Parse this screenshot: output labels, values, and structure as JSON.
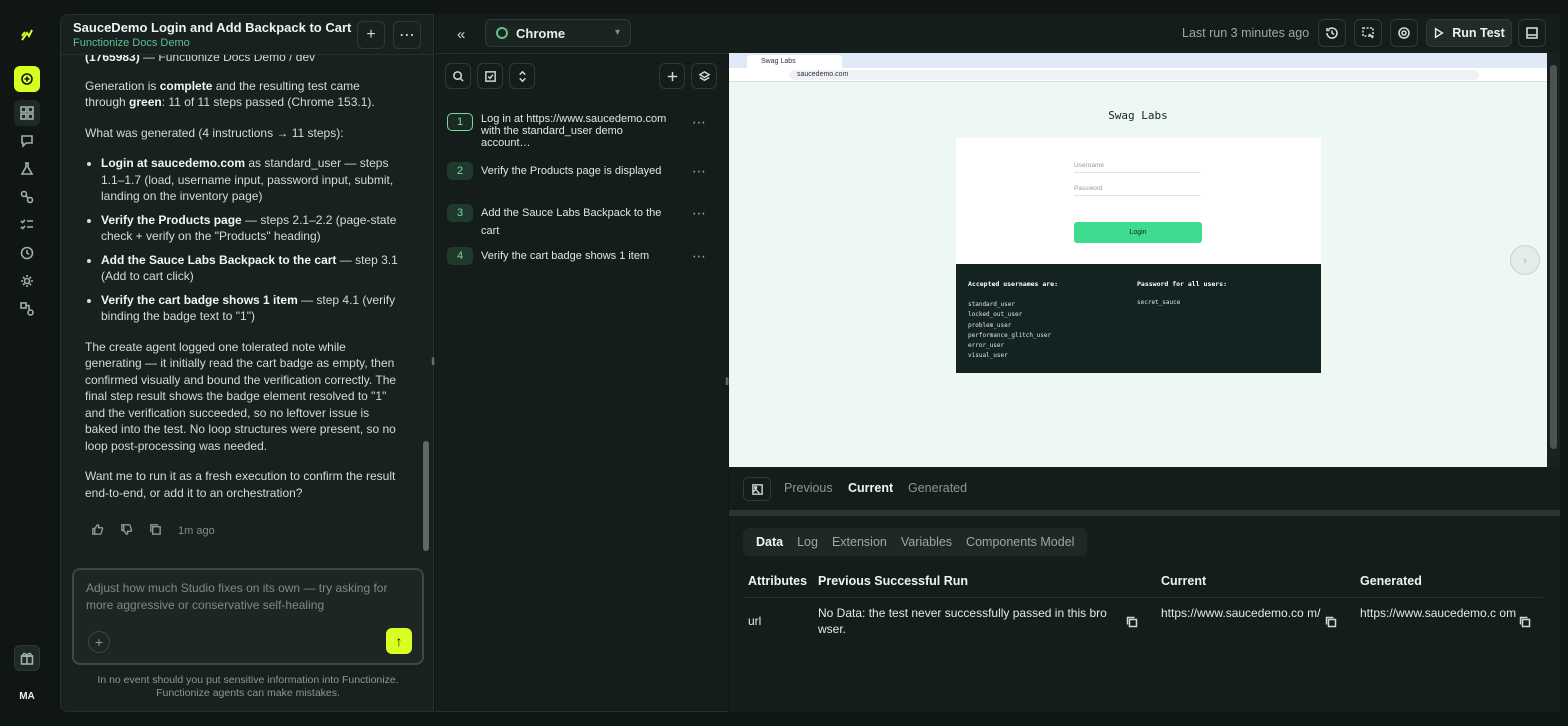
{
  "rail": {
    "user_initials": "MA"
  },
  "chat": {
    "title": "SauceDemo Login and Add Backpack to Cart",
    "subtitle": "Functionize Docs Demo",
    "top_partial": "(1765983) — Functionize Docs Demo / dev",
    "top_partial_bold": "(1765983)",
    "p1_pre": "Generation is ",
    "p1_b1": "complete",
    "p1_mid": " and the resulting test came through ",
    "p1_b2": "green",
    "p1_post": ": 11 of 11 steps passed (Chrome 153.1).",
    "p2": "What was generated (4 instructions → 11 steps):",
    "bullets": [
      {
        "bold": "Login at saucedemo.com",
        "text": " as standard_user — steps 1.1–1.7 (load, username input, password input, submit, landing on the inventory page)"
      },
      {
        "bold": "Verify the Products page",
        "text": " — steps 2.1–2.2 (page-state check + verify on the \"Products\" heading)"
      },
      {
        "bold": "Add the Sauce Labs Backpack to the cart",
        "text": " — step 3.1 (Add to cart click)"
      },
      {
        "bold": "Verify the cart badge shows 1 item",
        "text": " — step 4.1 (verify binding the badge text to \"1\")"
      }
    ],
    "p3": "The create agent logged one tolerated note while generating — it initially read the cart badge as empty, then confirmed visually and bound the verification correctly. The final step result shows the badge element resolved to \"1\" and the verification succeeded, so no leftover issue is baked into the test. No loop structures were present, so no loop post-processing was needed.",
    "p4": "Want me to run it as a fresh execution to confirm the result end-to-end, or add it to an orchestration?",
    "timestamp": "1m ago",
    "composer_placeholder": "Adjust how much Studio fixes on its own — try asking for more aggressive or conservative self-healing",
    "disclaimer_1": "In no event should you put sensitive information into Functionize.",
    "disclaimer_2": "Functionize agents can make mistakes."
  },
  "toolbar": {
    "browser": "Chrome",
    "last_run": "Last run 3 minutes ago",
    "run_label": "Run Test"
  },
  "steps": [
    {
      "num": "1",
      "text": "Log in at https://www.saucedemo.com with the standard_user demo account…"
    },
    {
      "num": "2",
      "text": "Verify the Products page is displayed"
    },
    {
      "num": "3",
      "text": "Add the Sauce Labs Backpack to the cart"
    },
    {
      "num": "4",
      "text": "Verify the cart badge shows 1 item"
    }
  ],
  "preview": {
    "tab_title": "Swag Labs",
    "url": "saucedemo.com",
    "logo": "Swag Labs",
    "username_ph": "Username",
    "password_ph": "Password",
    "login_btn": "Login",
    "accepted_title": "Accepted usernames are:",
    "usernames": [
      "standard_user",
      "locked_out_user",
      "problem_user",
      "performance_glitch_user",
      "error_user",
      "visual_user"
    ],
    "password_title": "Password for all users:",
    "password": "secret_sauce"
  },
  "snapshot_tabs": [
    "Previous",
    "Current",
    "Generated"
  ],
  "data_tabs": [
    "Data",
    "Log",
    "Extension",
    "Variables",
    "Components Model"
  ],
  "table": {
    "headers": [
      "Attributes",
      "Previous Successful Run",
      "Current",
      "Generated"
    ],
    "row": {
      "attr": "url",
      "previous": "No Data: the test never successfully passed in this bro wser.",
      "current": "https://www.saucedemo.co m/",
      "generated": "https://www.saucedemo.c om"
    }
  },
  "colors": {
    "accent": "#d8ff1f",
    "green": "#5fc08d",
    "bg": "#0f1614"
  }
}
